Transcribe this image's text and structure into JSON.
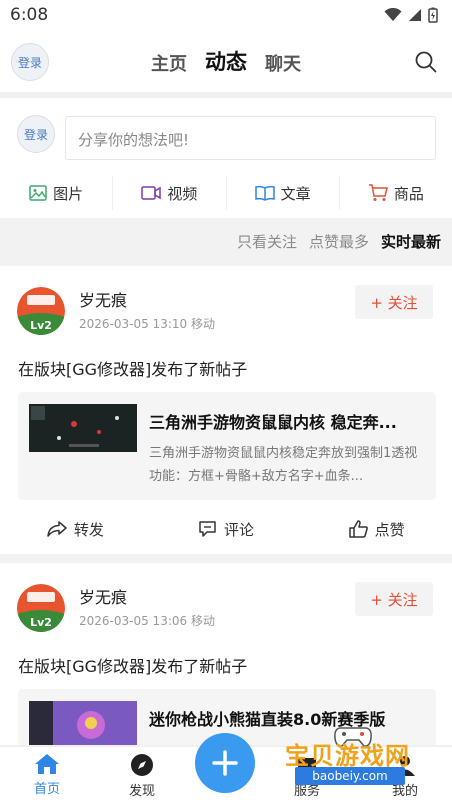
{
  "status_bar": {
    "time": "6:08"
  },
  "header": {
    "login_label": "登录",
    "tabs": [
      {
        "label": "主页",
        "active": false
      },
      {
        "label": "动态",
        "active": true
      },
      {
        "label": "聊天",
        "active": false
      }
    ]
  },
  "composer": {
    "login_label": "登录",
    "placeholder": "分享你的想法吧!",
    "media": [
      {
        "label": "图片",
        "icon": "image-icon",
        "color": "#3aa86b"
      },
      {
        "label": "视频",
        "icon": "video-icon",
        "color": "#7a3aa8"
      },
      {
        "label": "文章",
        "icon": "book-icon",
        "color": "#2f86e6"
      },
      {
        "label": "商品",
        "icon": "cart-icon",
        "color": "#e0503a"
      }
    ]
  },
  "filters": [
    {
      "label": "只看关注",
      "active": false
    },
    {
      "label": "点赞最多",
      "active": false
    },
    {
      "label": "实时最新",
      "active": true
    }
  ],
  "posts": [
    {
      "user": "岁无痕",
      "level": "Lv2",
      "meta": "2026-03-05 13:10 移动",
      "follow_label": "+ 关注",
      "text": "在版块[GG修改器]发布了新帖子",
      "card_title": "三角洲手游物资鼠鼠内核 稳定奔...",
      "card_desc": "三角洲手游物资鼠鼠内核稳定奔放到强制1透视功能：方框+骨骼+敌方名字+血条..."
    },
    {
      "user": "岁无痕",
      "level": "Lv2",
      "meta": "2026-03-05 13:06 移动",
      "follow_label": "+ 关注",
      "text": "在版块[GG修改器]发布了新帖子",
      "card_title": "迷你枪战小熊猫直装8.0新赛季版"
    }
  ],
  "post_actions": {
    "share": "转发",
    "comment": "评论",
    "like": "点赞"
  },
  "bottom_nav": [
    {
      "label": "首页",
      "active": true
    },
    {
      "label": "发现",
      "active": false
    },
    {
      "label": "服务",
      "active": false
    },
    {
      "label": "我的",
      "active": false
    }
  ],
  "watermark": {
    "text": "宝贝游戏网",
    "url": "baobeiy.com"
  },
  "colors": {
    "accent": "#2f86e6",
    "follow": "#e0503a",
    "fab": "#3a9af0"
  }
}
